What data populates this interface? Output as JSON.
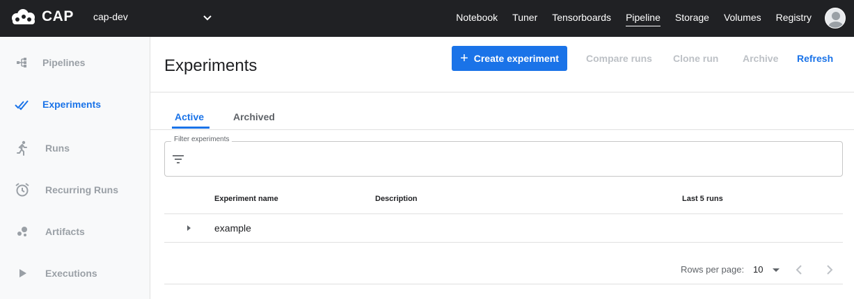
{
  "app": {
    "brand": "CAP",
    "namespace": "cap-dev"
  },
  "topnav": [
    "Notebook",
    "Tuner",
    "Tensorboards",
    "Pipeline",
    "Storage",
    "Volumes",
    "Registry"
  ],
  "topnav_active": "Pipeline",
  "sidebar": {
    "items": [
      {
        "label": "Pipelines",
        "icon": "pipelines-icon"
      },
      {
        "label": "Experiments",
        "icon": "experiments-icon",
        "active": true
      },
      {
        "label": "Runs",
        "icon": "runs-icon"
      },
      {
        "label": "Recurring Runs",
        "icon": "alarm-clock-icon"
      },
      {
        "label": "Artifacts",
        "icon": "artifacts-icon"
      },
      {
        "label": "Executions",
        "icon": "play-icon"
      }
    ]
  },
  "page": {
    "title": "Experiments"
  },
  "toolbar": {
    "create": "Create experiment",
    "compare": "Compare runs",
    "clone": "Clone run",
    "archive": "Archive",
    "refresh": "Refresh"
  },
  "tabs": {
    "active": "Active",
    "archived": "Archived"
  },
  "filter": {
    "label": "Filter experiments",
    "value": ""
  },
  "table": {
    "columns": [
      "Experiment name",
      "Description",
      "Last 5 runs"
    ],
    "rows": [
      {
        "name": "example",
        "description": "",
        "last_runs": ""
      }
    ]
  },
  "pagination": {
    "label": "Rows per page:",
    "value": "10"
  },
  "colors": {
    "accent": "#1a73e8",
    "topbar": "#202124",
    "sidebar": "#f8f9fa"
  }
}
